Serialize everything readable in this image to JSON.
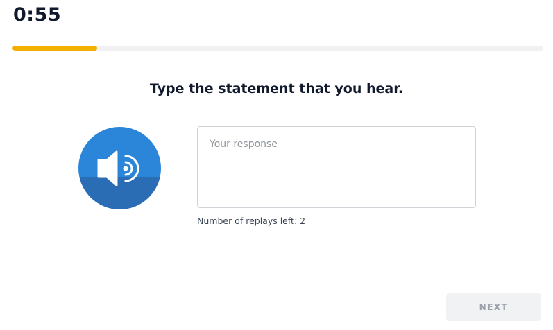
{
  "timer": {
    "text": "0:55"
  },
  "progress": {
    "fraction": 0.16,
    "color": "#f4b000"
  },
  "prompt": {
    "text": "Type the statement that you hear."
  },
  "audio": {
    "icon": "speaker-icon",
    "color": "#2b85d8"
  },
  "response": {
    "placeholder": "Your response",
    "value": ""
  },
  "replays": {
    "text": "Number of replays left: 2"
  },
  "footer": {
    "next_label": "NEXT"
  }
}
